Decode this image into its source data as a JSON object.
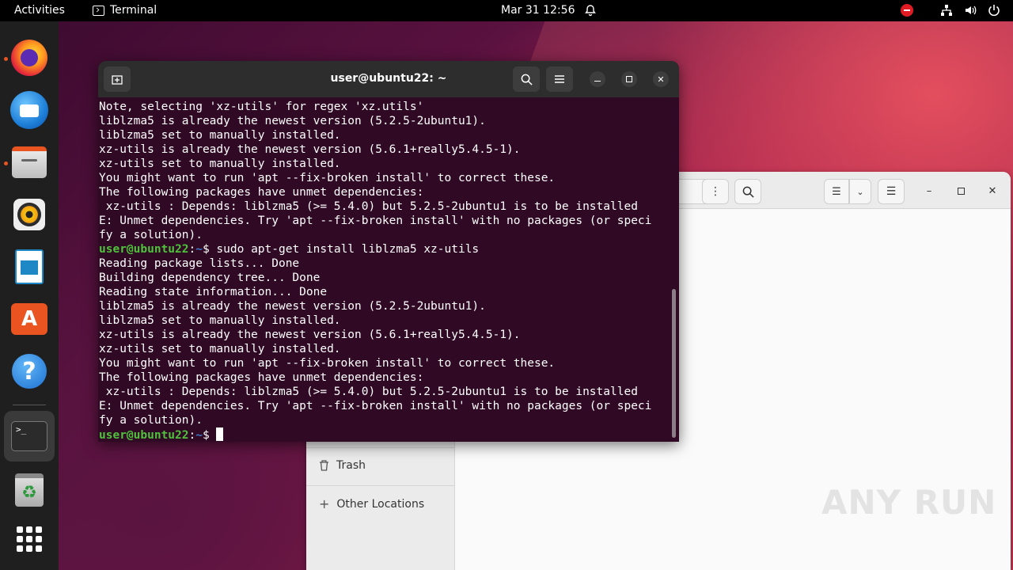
{
  "topbar": {
    "activities": "Activities",
    "app_name": "Terminal",
    "clock": "Mar 31  12:56"
  },
  "dock": {
    "items": [
      "Firefox",
      "Thunderbird",
      "Files",
      "Rhythmbox",
      "LibreOffice Writer",
      "Ubuntu Software",
      "Help",
      "Terminal",
      "Trash",
      "Show Applications"
    ]
  },
  "files_window": {
    "sidebar": {
      "trash": "Trash",
      "other_locations": "Other Locations"
    }
  },
  "terminal": {
    "title": "user@ubuntu22: ~",
    "prompt_user": "user@ubuntu22",
    "prompt_path": "~",
    "lines": [
      {
        "text": "Note, selecting 'xz-utils' for regex 'xz.utils'"
      },
      {
        "text": "liblzma5 is already the newest version (5.2.5-2ubuntu1)."
      },
      {
        "text": "liblzma5 set to manually installed."
      },
      {
        "text": "xz-utils is already the newest version (5.6.1+really5.4.5-1)."
      },
      {
        "text": "xz-utils set to manually installed."
      },
      {
        "text": "You might want to run 'apt --fix-broken install' to correct these."
      },
      {
        "text": "The following packages have unmet dependencies:"
      },
      {
        "text": " xz-utils : Depends: liblzma5 (>= 5.4.0) but 5.2.5-2ubuntu1 is to be installed"
      },
      {
        "text": "E: Unmet dependencies. Try 'apt --fix-broken install' with no packages (or speci"
      },
      {
        "text": "fy a solution)."
      },
      {
        "prompt": true,
        "text": "$ sudo apt-get install liblzma5 xz-utils"
      },
      {
        "text": "Reading package lists... Done"
      },
      {
        "text": "Building dependency tree... Done"
      },
      {
        "text": "Reading state information... Done"
      },
      {
        "text": "liblzma5 is already the newest version (5.2.5-2ubuntu1)."
      },
      {
        "text": "liblzma5 set to manually installed."
      },
      {
        "text": "xz-utils is already the newest version (5.6.1+really5.4.5-1)."
      },
      {
        "text": "xz-utils set to manually installed."
      },
      {
        "text": "You might want to run 'apt --fix-broken install' to correct these."
      },
      {
        "text": "The following packages have unmet dependencies:"
      },
      {
        "text": " xz-utils : Depends: liblzma5 (>= 5.4.0) but 5.2.5-2ubuntu1 is to be installed"
      },
      {
        "text": "E: Unmet dependencies. Try 'apt --fix-broken install' with no packages (or speci"
      },
      {
        "text": "fy a solution)."
      },
      {
        "prompt": true,
        "text": "$ ",
        "cursor": true
      }
    ]
  },
  "watermark": "ANY RUN",
  "colors": {
    "terminal_bg": "#300a24",
    "prompt_user": "#4fc13c",
    "prompt_path": "#3f77c9",
    "accent": "#e95420"
  }
}
